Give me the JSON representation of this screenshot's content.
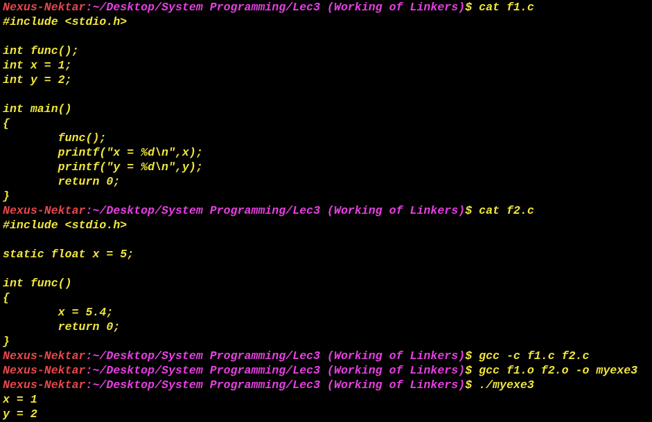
{
  "terminal": {
    "lines": [
      {
        "kind": "prompt",
        "user": "Nexus-Nektar",
        "path": ":~/Desktop/System Programming/Lec3 (Working of Linkers)",
        "symbol": "$ ",
        "command": "cat f1.c"
      },
      {
        "kind": "output",
        "text": "#include <stdio.h>"
      },
      {
        "kind": "output",
        "text": ""
      },
      {
        "kind": "output",
        "text": "int func();"
      },
      {
        "kind": "output",
        "text": "int x = 1;"
      },
      {
        "kind": "output",
        "text": "int y = 2;"
      },
      {
        "kind": "output",
        "text": ""
      },
      {
        "kind": "output",
        "text": "int main()"
      },
      {
        "kind": "output",
        "text": "{"
      },
      {
        "kind": "output",
        "text": "        func();"
      },
      {
        "kind": "output",
        "text": "        printf(\"x = %d\\n\",x);"
      },
      {
        "kind": "output",
        "text": "        printf(\"y = %d\\n\",y);"
      },
      {
        "kind": "output",
        "text": "        return 0;"
      },
      {
        "kind": "output",
        "text": "}"
      },
      {
        "kind": "prompt",
        "user": "Nexus-Nektar",
        "path": ":~/Desktop/System Programming/Lec3 (Working of Linkers)",
        "symbol": "$ ",
        "command": "cat f2.c"
      },
      {
        "kind": "output",
        "text": "#include <stdio.h>"
      },
      {
        "kind": "output",
        "text": ""
      },
      {
        "kind": "output",
        "text": "static float x = 5;"
      },
      {
        "kind": "output",
        "text": ""
      },
      {
        "kind": "output",
        "text": "int func()"
      },
      {
        "kind": "output",
        "text": "{"
      },
      {
        "kind": "output",
        "text": "        x = 5.4;"
      },
      {
        "kind": "output",
        "text": "        return 0;"
      },
      {
        "kind": "output",
        "text": "}"
      },
      {
        "kind": "prompt",
        "user": "Nexus-Nektar",
        "path": ":~/Desktop/System Programming/Lec3 (Working of Linkers)",
        "symbol": "$ ",
        "command": "gcc -c f1.c f2.c"
      },
      {
        "kind": "prompt",
        "user": "Nexus-Nektar",
        "path": ":~/Desktop/System Programming/Lec3 (Working of Linkers)",
        "symbol": "$ ",
        "command": "gcc f1.o f2.o -o myexe3"
      },
      {
        "kind": "prompt",
        "user": "Nexus-Nektar",
        "path": ":~/Desktop/System Programming/Lec3 (Working of Linkers)",
        "symbol": "$ ",
        "command": "./myexe3"
      },
      {
        "kind": "output",
        "text": "x = 1"
      },
      {
        "kind": "output",
        "text": "y = 2"
      }
    ]
  },
  "colors": {
    "background": "#000000",
    "user": "#e5484d",
    "path": "#e540e0",
    "text": "#f0e63c"
  }
}
